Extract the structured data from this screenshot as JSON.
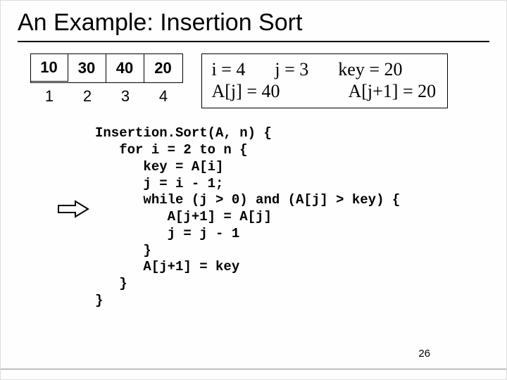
{
  "title": "An Example: Insertion Sort",
  "array": {
    "c0": "10",
    "c1": "30",
    "c2": "40",
    "c3": "20"
  },
  "index": {
    "i0": "1",
    "i1": "2",
    "i2": "3",
    "i3": "4"
  },
  "state": {
    "i": "i = 4",
    "j": "j = 3",
    "key": "key = 20",
    "aj": "A[j] = 40",
    "ajp1": "A[j+1] = 20"
  },
  "code": {
    "l0": "Insertion.Sort(A, n) {",
    "l1": "   for i = 2 to n {",
    "l2": "      key = A[i]",
    "l3": "      j = i - 1;",
    "l4": "      while (j > 0) and (A[j] > key) {",
    "l5": "         A[j+1] = A[j]",
    "l6": "         j = j - 1",
    "l7": "      }",
    "l8": "      A[j+1] = key",
    "l9": "   }",
    "l10": "}"
  },
  "pagenum": "26"
}
